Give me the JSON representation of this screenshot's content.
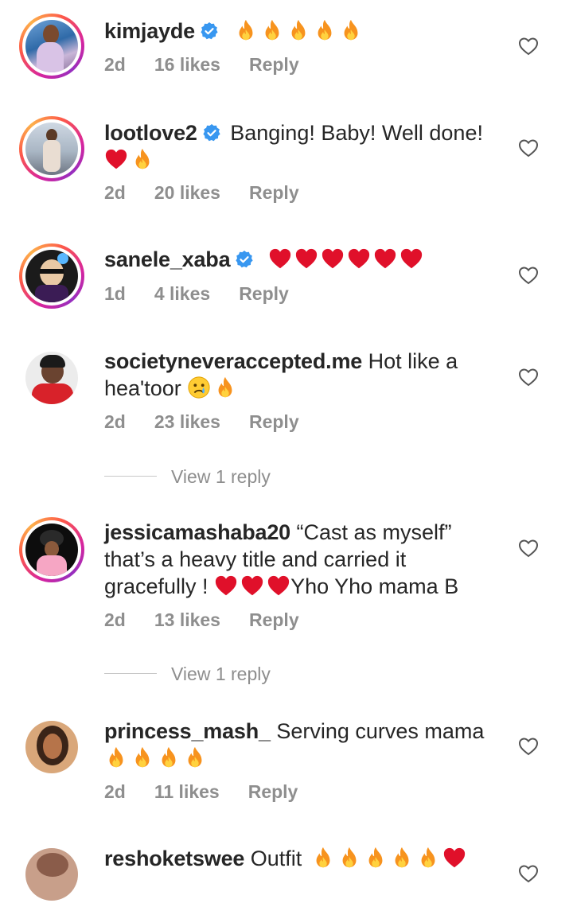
{
  "comments": [
    {
      "username": "kimjayde",
      "verified": true,
      "text": "",
      "emojis": [
        "fire",
        "fire",
        "fire",
        "fire",
        "fire"
      ],
      "age": "2d",
      "likes": "16 likes",
      "reply": "Reply"
    },
    {
      "username": "lootlove2",
      "verified": true,
      "text": "Banging! Baby!  Well done!",
      "emojis_line2": [
        "heart",
        "fire"
      ],
      "age": "2d",
      "likes": "20 likes",
      "reply": "Reply"
    },
    {
      "username": "sanele_xaba",
      "verified": true,
      "text": "",
      "emojis": [
        "heart",
        "heart",
        "heart",
        "heart",
        "heart",
        "heart"
      ],
      "age": "1d",
      "likes": "4 likes",
      "reply": "Reply"
    },
    {
      "username": "societyneveraccepted.me",
      "verified": false,
      "text": "Hot like a",
      "text2": "hea'toor",
      "emojis_line2": [
        "crying-face",
        "fire"
      ],
      "age": "2d",
      "likes": "23 likes",
      "reply": "Reply"
    },
    {
      "username": "jessicamashaba20",
      "verified": false,
      "text": "“Cast as myself”",
      "text2": "that’s a heavy title and carried it",
      "text3a": "gracefully !",
      "text3b": "Yho Yho mama B",
      "emojis_line3": [
        "heart",
        "heart",
        "heart"
      ],
      "age": "2d",
      "likes": "13 likes",
      "reply": "Reply"
    },
    {
      "username": "princess_mash_",
      "verified": false,
      "text": "Serving curves mama",
      "emojis_line2": [
        "fire",
        "fire",
        "fire",
        "fire"
      ],
      "age": "2d",
      "likes": "11 likes",
      "reply": "Reply"
    },
    {
      "username": "reshoketswee",
      "verified": false,
      "text": "Outfit",
      "emojis": [
        "fire",
        "fire",
        "fire",
        "fire",
        "fire",
        "heart"
      ]
    }
  ],
  "view_replies_1": "View 1 reply",
  "view_replies_2": "View 1 reply",
  "colors": {
    "meta": "#8e8e8e",
    "verified": "#3897f0",
    "heart": "#e0102a",
    "fire": "#f7931e"
  }
}
